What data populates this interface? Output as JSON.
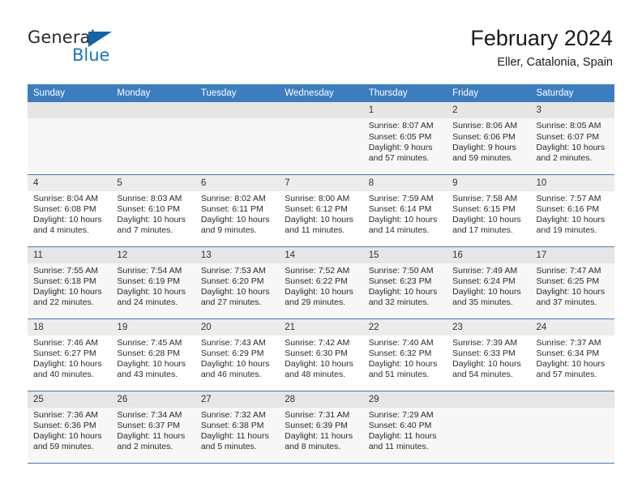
{
  "brand": {
    "name_top": "General",
    "name_bottom": "Blue",
    "triangle_color": "#1464a5",
    "blue_color": "#1878c4"
  },
  "header": {
    "title": "February 2024",
    "location": "Eller, Catalonia, Spain"
  },
  "theme": {
    "header_row_bg": "#3b7dbf",
    "header_row_text": "#ffffff",
    "row_alt_bg": "#f7f7f7",
    "daynum_bg": "#ececec",
    "grid_line": "#3b7dbf"
  },
  "weekdays": [
    "Sunday",
    "Monday",
    "Tuesday",
    "Wednesday",
    "Thursday",
    "Friday",
    "Saturday"
  ],
  "labels": {
    "sunrise_prefix": "Sunrise:",
    "sunset_prefix": "Sunset:",
    "daylight_prefix": "Daylight:"
  },
  "weeks": [
    [
      {
        "day": "",
        "blank": true
      },
      {
        "day": "",
        "blank": true
      },
      {
        "day": "",
        "blank": true
      },
      {
        "day": "",
        "blank": true
      },
      {
        "day": "1",
        "sunrise": "Sunrise: 8:07 AM",
        "sunset": "Sunset: 6:05 PM",
        "daylight": "Daylight: 9 hours and 57 minutes."
      },
      {
        "day": "2",
        "sunrise": "Sunrise: 8:06 AM",
        "sunset": "Sunset: 6:06 PM",
        "daylight": "Daylight: 9 hours and 59 minutes."
      },
      {
        "day": "3",
        "sunrise": "Sunrise: 8:05 AM",
        "sunset": "Sunset: 6:07 PM",
        "daylight": "Daylight: 10 hours and 2 minutes."
      }
    ],
    [
      {
        "day": "4",
        "sunrise": "Sunrise: 8:04 AM",
        "sunset": "Sunset: 6:08 PM",
        "daylight": "Daylight: 10 hours and 4 minutes."
      },
      {
        "day": "5",
        "sunrise": "Sunrise: 8:03 AM",
        "sunset": "Sunset: 6:10 PM",
        "daylight": "Daylight: 10 hours and 7 minutes."
      },
      {
        "day": "6",
        "sunrise": "Sunrise: 8:02 AM",
        "sunset": "Sunset: 6:11 PM",
        "daylight": "Daylight: 10 hours and 9 minutes."
      },
      {
        "day": "7",
        "sunrise": "Sunrise: 8:00 AM",
        "sunset": "Sunset: 6:12 PM",
        "daylight": "Daylight: 10 hours and 11 minutes."
      },
      {
        "day": "8",
        "sunrise": "Sunrise: 7:59 AM",
        "sunset": "Sunset: 6:14 PM",
        "daylight": "Daylight: 10 hours and 14 minutes."
      },
      {
        "day": "9",
        "sunrise": "Sunrise: 7:58 AM",
        "sunset": "Sunset: 6:15 PM",
        "daylight": "Daylight: 10 hours and 17 minutes."
      },
      {
        "day": "10",
        "sunrise": "Sunrise: 7:57 AM",
        "sunset": "Sunset: 6:16 PM",
        "daylight": "Daylight: 10 hours and 19 minutes."
      }
    ],
    [
      {
        "day": "11",
        "sunrise": "Sunrise: 7:55 AM",
        "sunset": "Sunset: 6:18 PM",
        "daylight": "Daylight: 10 hours and 22 minutes."
      },
      {
        "day": "12",
        "sunrise": "Sunrise: 7:54 AM",
        "sunset": "Sunset: 6:19 PM",
        "daylight": "Daylight: 10 hours and 24 minutes."
      },
      {
        "day": "13",
        "sunrise": "Sunrise: 7:53 AM",
        "sunset": "Sunset: 6:20 PM",
        "daylight": "Daylight: 10 hours and 27 minutes."
      },
      {
        "day": "14",
        "sunrise": "Sunrise: 7:52 AM",
        "sunset": "Sunset: 6:22 PM",
        "daylight": "Daylight: 10 hours and 29 minutes."
      },
      {
        "day": "15",
        "sunrise": "Sunrise: 7:50 AM",
        "sunset": "Sunset: 6:23 PM",
        "daylight": "Daylight: 10 hours and 32 minutes."
      },
      {
        "day": "16",
        "sunrise": "Sunrise: 7:49 AM",
        "sunset": "Sunset: 6:24 PM",
        "daylight": "Daylight: 10 hours and 35 minutes."
      },
      {
        "day": "17",
        "sunrise": "Sunrise: 7:47 AM",
        "sunset": "Sunset: 6:25 PM",
        "daylight": "Daylight: 10 hours and 37 minutes."
      }
    ],
    [
      {
        "day": "18",
        "sunrise": "Sunrise: 7:46 AM",
        "sunset": "Sunset: 6:27 PM",
        "daylight": "Daylight: 10 hours and 40 minutes."
      },
      {
        "day": "19",
        "sunrise": "Sunrise: 7:45 AM",
        "sunset": "Sunset: 6:28 PM",
        "daylight": "Daylight: 10 hours and 43 minutes."
      },
      {
        "day": "20",
        "sunrise": "Sunrise: 7:43 AM",
        "sunset": "Sunset: 6:29 PM",
        "daylight": "Daylight: 10 hours and 46 minutes."
      },
      {
        "day": "21",
        "sunrise": "Sunrise: 7:42 AM",
        "sunset": "Sunset: 6:30 PM",
        "daylight": "Daylight: 10 hours and 48 minutes."
      },
      {
        "day": "22",
        "sunrise": "Sunrise: 7:40 AM",
        "sunset": "Sunset: 6:32 PM",
        "daylight": "Daylight: 10 hours and 51 minutes."
      },
      {
        "day": "23",
        "sunrise": "Sunrise: 7:39 AM",
        "sunset": "Sunset: 6:33 PM",
        "daylight": "Daylight: 10 hours and 54 minutes."
      },
      {
        "day": "24",
        "sunrise": "Sunrise: 7:37 AM",
        "sunset": "Sunset: 6:34 PM",
        "daylight": "Daylight: 10 hours and 57 minutes."
      }
    ],
    [
      {
        "day": "25",
        "sunrise": "Sunrise: 7:36 AM",
        "sunset": "Sunset: 6:36 PM",
        "daylight": "Daylight: 10 hours and 59 minutes."
      },
      {
        "day": "26",
        "sunrise": "Sunrise: 7:34 AM",
        "sunset": "Sunset: 6:37 PM",
        "daylight": "Daylight: 11 hours and 2 minutes."
      },
      {
        "day": "27",
        "sunrise": "Sunrise: 7:32 AM",
        "sunset": "Sunset: 6:38 PM",
        "daylight": "Daylight: 11 hours and 5 minutes."
      },
      {
        "day": "28",
        "sunrise": "Sunrise: 7:31 AM",
        "sunset": "Sunset: 6:39 PM",
        "daylight": "Daylight: 11 hours and 8 minutes."
      },
      {
        "day": "29",
        "sunrise": "Sunrise: 7:29 AM",
        "sunset": "Sunset: 6:40 PM",
        "daylight": "Daylight: 11 hours and 11 minutes."
      },
      {
        "day": "",
        "blank": true
      },
      {
        "day": "",
        "blank": true
      }
    ]
  ]
}
